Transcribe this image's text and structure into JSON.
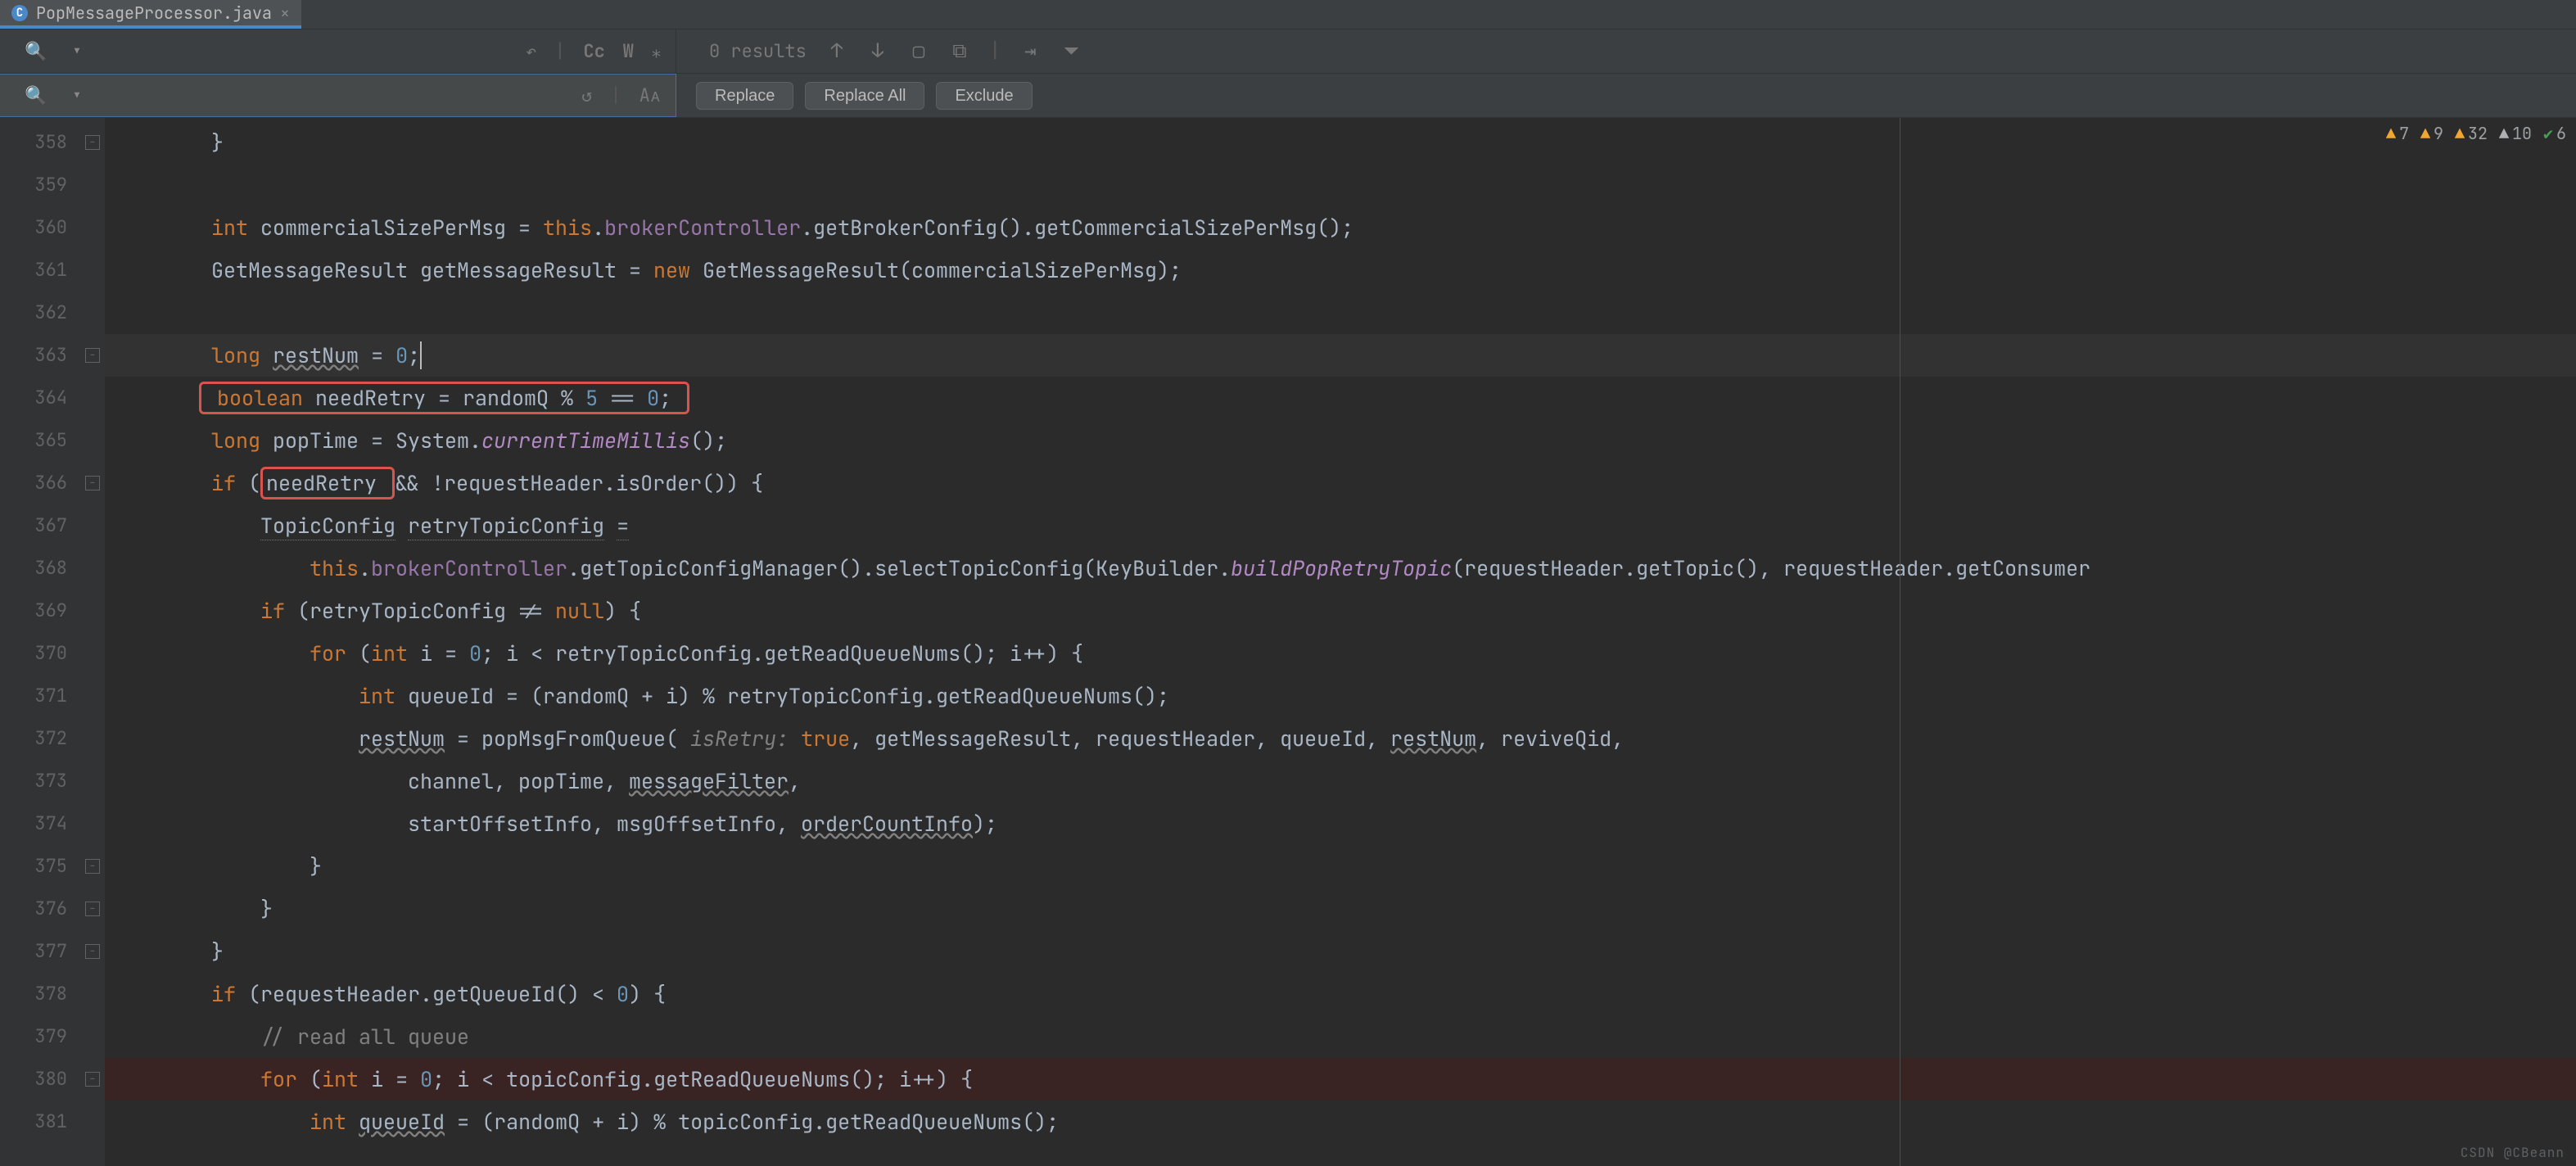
{
  "tab": {
    "icon_letter": "C",
    "label": "PopMessageProcessor.java",
    "close": "×"
  },
  "search": {
    "icon": "🔍",
    "dropdown": "▾",
    "opts": {
      "prev": "↶",
      "cc": "Cc",
      "word": "W",
      "regex": "⁎"
    },
    "results": "0 results",
    "nav": {
      "up": "↑",
      "down": "↓",
      "select_all": "▢",
      "add": "⧉",
      "collapse": "⇥",
      "filter": "⏷"
    }
  },
  "replace": {
    "icon": "🔍",
    "dropdown": "▾",
    "opts": {
      "undo": "↺",
      "case": "Aᴀ"
    },
    "btn_replace": "Replace",
    "btn_replace_all": "Replace All",
    "btn_exclude": "Exclude"
  },
  "gutter": {
    "start": 358,
    "end": 381
  },
  "fold_marks": [
    {
      "line": 358,
      "sym": "−"
    },
    {
      "line": 363,
      "sym": "−"
    },
    {
      "line": 366,
      "sym": "−"
    },
    {
      "line": 375,
      "sym": "−"
    },
    {
      "line": 376,
      "sym": "−"
    },
    {
      "line": 377,
      "sym": "−"
    },
    {
      "line": 380,
      "sym": "−"
    }
  ],
  "breakpoints": [
    380
  ],
  "inspections": [
    {
      "icon_class": "tri-err",
      "icon": "▲",
      "count": "7"
    },
    {
      "icon_class": "tri-err",
      "icon": "▲",
      "count": "9"
    },
    {
      "icon_class": "tri-err",
      "icon": "▲",
      "count": "32"
    },
    {
      "icon_class": "tri-warn",
      "icon": "▲",
      "count": "10"
    },
    {
      "icon_class": "chk",
      "icon": "✔",
      "count": "6"
    }
  ],
  "code": [
    {
      "n": 358,
      "html": "        }"
    },
    {
      "n": 359,
      "html": ""
    },
    {
      "n": 360,
      "html": "        <span class='kw'>int</span> commercialSizePerMsg = <span class='kw'>this</span>.<span class='field'>brokerController</span>.getBrokerConfig().getCommercialSizePerMsg();"
    },
    {
      "n": 361,
      "html": "        GetMessageResult getMessageResult = <span class='kw'>new</span> GetMessageResult(commercialSizePerMsg);"
    },
    {
      "n": 362,
      "html": ""
    },
    {
      "n": 363,
      "html": "        <span class='kw'>long</span> <span class='und'>restNum</span> = <span class='num'>0</span>;<span class='caret'></span>",
      "caret": true
    },
    {
      "n": 364,
      "html": "       <span class='redbox'> <span class='kw'>boolean</span> needRetry = randomQ % <span class='num'>5</span> == <span class='num'>0</span>; </span>"
    },
    {
      "n": 365,
      "html": "        <span class='kw'>long</span> popTime = System.<span class='ital'>currentTimeMillis</span>();"
    },
    {
      "n": 366,
      "html": "        <span class='kw'>if</span> (<span class='redbox'>needRetry </span>&amp;&amp; !requestHeader.isOrder()) {"
    },
    {
      "n": 367,
      "html": "            <span class='dotted'>TopicConfig</span> <span class='dotted'>retryTopicConfig</span> <span class='dotted'>=</span>"
    },
    {
      "n": 368,
      "html": "                <span class='kw'>this</span>.<span class='field'>brokerController</span>.getTopicConfigManager().selectTopicConfig(KeyBuilder.<span class='ital'>buildPopRetryTopic</span>(requestHeader.getTopic(), requestHeader.getConsumer"
    },
    {
      "n": 369,
      "html": "            <span class='kw'>if</span> (retryTopicConfig != <span class='kw'>null</span>) {"
    },
    {
      "n": 370,
      "html": "                <span class='kw'>for</span> (<span class='kw'>int</span> i = <span class='num'>0</span>; i &lt; retryTopicConfig.getReadQueueNums(); i++) {"
    },
    {
      "n": 371,
      "html": "                    <span class='kw'>int</span> queueId = (randomQ + i) % retryTopicConfig.getReadQueueNums();"
    },
    {
      "n": 372,
      "html": "                    <span class='und'>restNum</span> = popMsgFromQueue( <span class='param'>isRetry:</span> <span class='kw'>true</span>, getMessageResult, requestHeader, queueId, <span class='und'>restNum</span>, reviveQid,"
    },
    {
      "n": 373,
      "html": "                        channel, popTime, <span class='und'>messageFilter</span>,"
    },
    {
      "n": 374,
      "html": "                        startOffsetInfo, msgOffsetInfo, <span class='und'>orderCountInfo</span>);"
    },
    {
      "n": 375,
      "html": "                }"
    },
    {
      "n": 376,
      "html": "            }"
    },
    {
      "n": 377,
      "html": "        }"
    },
    {
      "n": 378,
      "html": "        <span class='kw'>if</span> (requestHeader.getQueueId() &lt; <span class='num'>0</span>) {"
    },
    {
      "n": 379,
      "html": "            <span class='cmt'>// read all queue</span>"
    },
    {
      "n": 380,
      "html": "            <span class='kw'>for</span> (<span class='kw'>int</span> i = <span class='num'>0</span>; i &lt; topicConfig.getReadQueueNums(); i++) {",
      "bp": true
    },
    {
      "n": 381,
      "html": "                <span class='kw'>int</span> <span class='und'>queueId</span> = (randomQ + i) % topicConfig.getReadQueueNums();"
    }
  ],
  "watermark": "CSDN @CBeann"
}
